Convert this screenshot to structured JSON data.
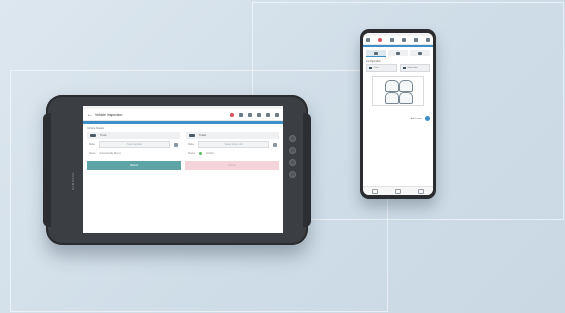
{
  "tablet": {
    "app_title": "Vehicle Inspection",
    "section_label": "Vehicle Details",
    "left_column": {
      "header": "Truck",
      "field1_label": "Make",
      "field1_placeholder": "Scan barcode",
      "field2_label": "Notes",
      "field2_value": "Automatically filled in"
    },
    "right_column": {
      "header": "Trailer",
      "field1_label": "Make",
      "field1_placeholder": "Select trailer unit",
      "field2_label": "Status",
      "field2_value": "Verified"
    },
    "primary_button": "Submit",
    "secondary_button": "Cancel",
    "brand_label": "SAMSUNG"
  },
  "phone": {
    "section_label": "Configuration",
    "option1": "Truck",
    "option2": "Semi Trailer",
    "setting_label": "Add Tractor",
    "setting_on": true
  },
  "colors": {
    "accent_blue": "#3e8ec7",
    "primary_button": "#5ea3a5",
    "secondary_button": "#f4d3da",
    "alert_red": "#d94c5a"
  }
}
